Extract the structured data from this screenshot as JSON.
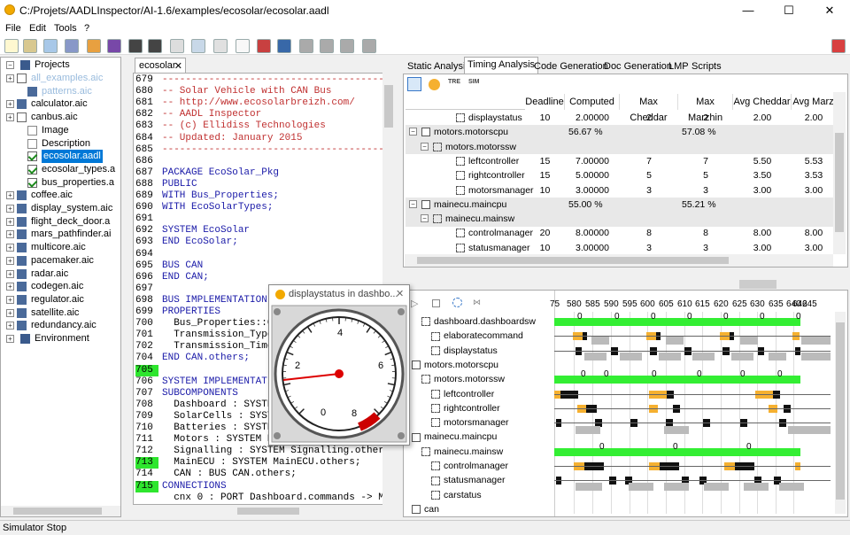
{
  "window": {
    "title": "C:/Projets/AADLInspector/AI-1.6/examples/ecosolar/ecosolar.aadl",
    "minimize": "—",
    "maximize": "☐",
    "close": "✕"
  },
  "menu": [
    "File",
    "Edit",
    "Tools",
    "?"
  ],
  "tree": {
    "root": "Projects",
    "items": [
      {
        "label": "all_examples.aic",
        "muted": true
      },
      {
        "label": "patterns.aic",
        "muted": true
      },
      {
        "label": "calculator.aic"
      },
      {
        "label": "canbus.aic"
      },
      {
        "label": "Image"
      },
      {
        "label": "Description"
      },
      {
        "label": "ecosolar.aadl",
        "selected": true
      },
      {
        "label": "ecosolar_types.a"
      },
      {
        "label": "bus_properties.a"
      },
      {
        "label": "coffee.aic"
      },
      {
        "label": "display_system.aic"
      },
      {
        "label": "flight_deck_door.a"
      },
      {
        "label": "mars_pathfinder.ai"
      },
      {
        "label": "multicore.aic"
      },
      {
        "label": "pacemaker.aic"
      },
      {
        "label": "radar.aic"
      },
      {
        "label": "codegen.aic"
      },
      {
        "label": "regulator.aic"
      },
      {
        "label": "satellite.aic"
      },
      {
        "label": "redundancy.aic"
      },
      {
        "label": "Environment"
      }
    ]
  },
  "editor": {
    "tab": "ecosolar",
    "lines": [
      {
        "n": "679",
        "t": "--------------------------------------------",
        "c": "cm"
      },
      {
        "n": "680",
        "t": "-- Solar Vehicle with CAN Bus",
        "c": "cm"
      },
      {
        "n": "681",
        "t": "-- http://www.ecosolarbreizh.com/",
        "c": "cm"
      },
      {
        "n": "682",
        "t": "-- AADL Inspector",
        "c": "cm"
      },
      {
        "n": "683",
        "t": "-- (c) Ellidiss Technologies",
        "c": "cm"
      },
      {
        "n": "684",
        "t": "-- Updated: January 2015",
        "c": "cm"
      },
      {
        "n": "685",
        "t": "--------------------------------------------",
        "c": "cm"
      },
      {
        "n": "686",
        "t": "",
        "c": ""
      },
      {
        "n": "687",
        "t": "PACKAGE EcoSolar_Pkg",
        "c": "kw"
      },
      {
        "n": "688",
        "t": "PUBLIC",
        "c": "kw"
      },
      {
        "n": "689",
        "t": "WITH Bus_Properties;",
        "c": "kw"
      },
      {
        "n": "690",
        "t": "WITH EcoSolarTypes;",
        "c": "kw"
      },
      {
        "n": "691",
        "t": "",
        "c": ""
      },
      {
        "n": "692",
        "t": "SYSTEM EcoSolar",
        "c": "kw"
      },
      {
        "n": "693",
        "t": "END EcoSolar;",
        "c": "kw"
      },
      {
        "n": "694",
        "t": "",
        "c": ""
      },
      {
        "n": "695",
        "t": "BUS CAN",
        "c": "kw"
      },
      {
        "n": "696",
        "t": "END CAN;",
        "c": "kw"
      },
      {
        "n": "697",
        "t": "",
        "c": ""
      },
      {
        "n": "698",
        "t": "BUS IMPLEMENTATION",
        "c": "kw"
      },
      {
        "n": "699",
        "t": "PROPERTIES",
        "c": "kw"
      },
      {
        "n": "700",
        "t": "  Bus_Properties::C",
        "c": ""
      },
      {
        "n": "701",
        "t": "  Transmission_Type",
        "c": ""
      },
      {
        "n": "702",
        "t": "  Transmission_Time",
        "c": ""
      },
      {
        "n": "704",
        "t": "END CAN.others;",
        "c": "kw"
      },
      {
        "n": "705",
        "t": "",
        "c": "",
        "hl": true
      },
      {
        "n": "706",
        "t": "SYSTEM IMPLEMENTATI",
        "c": "kw"
      },
      {
        "n": "707",
        "t": "SUBCOMPONENTS",
        "c": "kw"
      },
      {
        "n": "708",
        "t": "  Dashboard : SYSTE",
        "c": ""
      },
      {
        "n": "709",
        "t": "  SolarCells : SYST",
        "c": ""
      },
      {
        "n": "710",
        "t": "  Batteries : SYSTE",
        "c": ""
      },
      {
        "n": "711",
        "t": "  Motors : SYSTEM N",
        "c": ""
      },
      {
        "n": "712",
        "t": "  Signalling : SYSTEM Signalling.other",
        "c": ""
      },
      {
        "n": "713",
        "t": "  MainECU : SYSTEM MainECU.others;",
        "c": "",
        "hl": true
      },
      {
        "n": "714",
        "t": "  CAN : BUS CAN.others;",
        "c": ""
      },
      {
        "n": "715",
        "t": "CONNECTIONS",
        "c": "kw",
        "hl": true
      },
      {
        "n": "",
        "t": "  cnx 0 : PORT Dashboard.commands -> M",
        "c": ""
      }
    ]
  },
  "right_tabs": [
    "Static Analysis",
    "Timing Analysis",
    "Code Generation",
    "Doc Generation",
    "LMP",
    "Scripts"
  ],
  "timing": {
    "columns": [
      "Deadline",
      "Computed",
      "Max Cheddar",
      "Max Marzhin",
      "Avg Cheddar",
      "Avg Marz"
    ],
    "rows": [
      {
        "name": "displaystatus",
        "indent": 3,
        "vals": [
          "10",
          "2.00000",
          "2",
          "2",
          "2.00",
          "2.00"
        ]
      },
      {
        "name": "motors.motorscpu",
        "indent": 0,
        "grp": true,
        "vals": [
          "",
          "56.67 %",
          "",
          "57.08 %",
          "",
          ""
        ]
      },
      {
        "name": "motors.motorssw",
        "indent": 1,
        "grp": true,
        "vals": [
          "",
          "",
          "",
          "",
          "",
          ""
        ]
      },
      {
        "name": "leftcontroller",
        "indent": 3,
        "vals": [
          "15",
          "7.00000",
          "7",
          "7",
          "5.50",
          "5.53"
        ]
      },
      {
        "name": "rightcontroller",
        "indent": 3,
        "vals": [
          "15",
          "5.00000",
          "5",
          "5",
          "3.50",
          "3.53"
        ]
      },
      {
        "name": "motorsmanager",
        "indent": 3,
        "vals": [
          "10",
          "3.00000",
          "3",
          "3",
          "3.00",
          "3.00"
        ]
      },
      {
        "name": "mainecu.maincpu",
        "indent": 0,
        "grp": true,
        "vals": [
          "",
          "55.00 %",
          "",
          "55.21 %",
          "",
          ""
        ]
      },
      {
        "name": "mainecu.mainsw",
        "indent": 1,
        "grp": true,
        "vals": [
          "",
          "",
          "",
          "",
          "",
          ""
        ]
      },
      {
        "name": "controlmanager",
        "indent": 3,
        "vals": [
          "20",
          "8.00000",
          "8",
          "8",
          "8.00",
          "8.00"
        ]
      },
      {
        "name": "statusmanager",
        "indent": 3,
        "vals": [
          "10",
          "3.00000",
          "3",
          "3",
          "3.00",
          "3.00"
        ]
      }
    ]
  },
  "gantt": {
    "ticks": [
      "75",
      "580",
      "585",
      "590",
      "595",
      "600",
      "605",
      "610",
      "615",
      "620",
      "625",
      "630",
      "635",
      "640",
      "642",
      "645"
    ],
    "rows": [
      "dashboard.dashboardsw",
      "elaboratecommand",
      "displaystatus",
      "motors.motorscpu",
      "motors.motorssw",
      "leftcontroller",
      "rightcontroller",
      "motorsmanager",
      "mainecu.maincpu",
      "mainecu.mainsw",
      "controlmanager",
      "statusmanager",
      "carstatus",
      "can"
    ],
    "zero": "0"
  },
  "gauge": {
    "title": "displaystatus in dashbo...",
    "labels": [
      "0",
      "2",
      "4",
      "6",
      "8"
    ],
    "close": "✕",
    "value": 2
  },
  "status": "Simulator Stop",
  "colors": {
    "accent": "#0078d7",
    "green": "#33ee33",
    "orange": "#f5b030"
  }
}
